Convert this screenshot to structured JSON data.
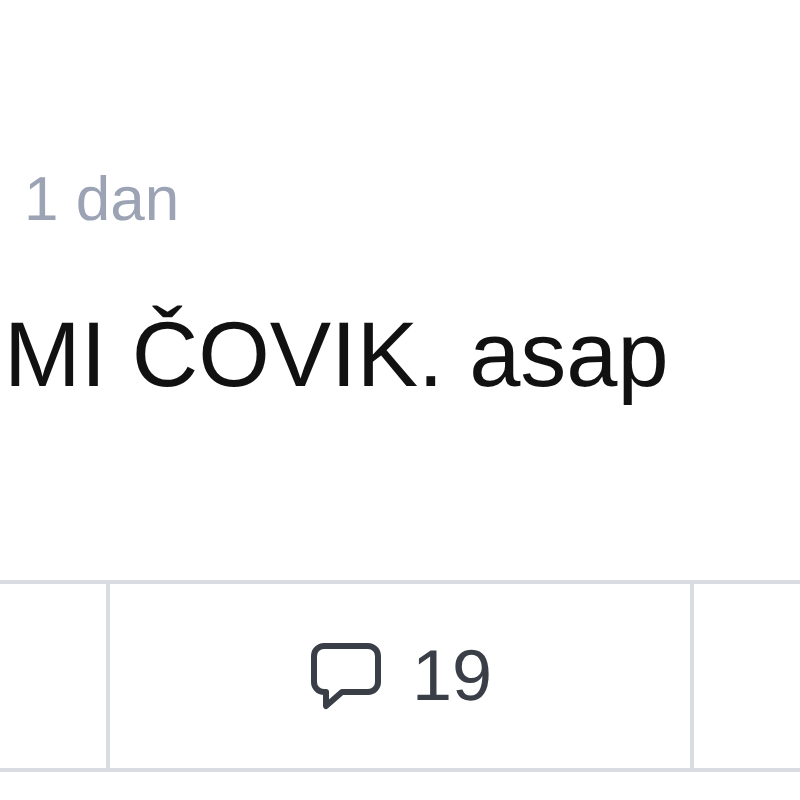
{
  "post": {
    "time": "1 dan",
    "text": "MI ČOVIK. asap"
  },
  "actions": [
    {
      "kind": "comment",
      "count": "19"
    }
  ]
}
